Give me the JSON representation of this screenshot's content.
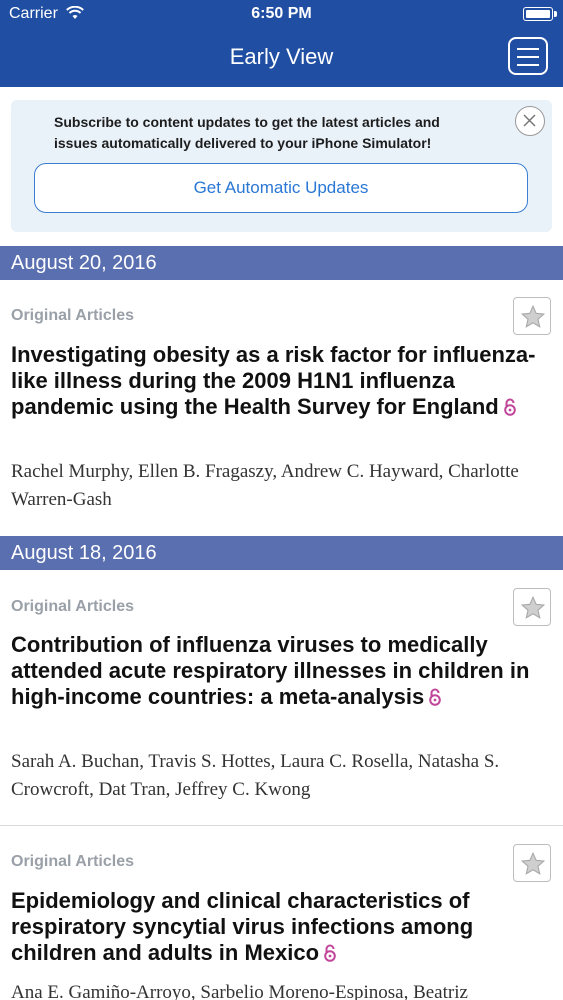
{
  "status_bar": {
    "carrier": "Carrier",
    "time": "6:50 PM"
  },
  "nav": {
    "title": "Early View",
    "menu_icon": "hamburger-menu-icon"
  },
  "subscribe": {
    "message": "Subscribe to content updates to get the latest articles and issues automatically delivered to your iPhone Simulator!",
    "button_label": "Get Automatic Updates",
    "close_icon": "close-icon"
  },
  "groups": [
    {
      "date": "August 20, 2016",
      "articles": [
        {
          "section": "Original Articles",
          "title": "Investigating obesity as a risk factor for influenza-like illness during the 2009 H1N1 influenza pandemic using the Health Survey for England",
          "open_access": true,
          "authors": "Rachel Murphy, Ellen B. Fragaszy, Andrew C. Hayward, Charlotte Warren-Gash"
        }
      ]
    },
    {
      "date": "August 18, 2016",
      "articles": [
        {
          "section": "Original Articles",
          "title": "Contribution of influenza viruses to medically attended acute respiratory illnesses in children in high-income countries: a meta-analysis",
          "open_access": true,
          "authors": "Sarah A. Buchan, Travis S. Hottes, Laura C. Rosella, Natasha S. Crowcroft, Dat Tran, Jeffrey C. Kwong"
        },
        {
          "section": "Original Articles",
          "title": "Epidemiology and clinical characteristics of respiratory syncytial virus infections among children and adults in Mexico",
          "open_access": true,
          "authors": "Ana E. Gamiño-Arroyo, Sarbelio Moreno-Espinosa, Beatriz"
        }
      ]
    }
  ],
  "colors": {
    "nav_bg": "#1f4ea3",
    "date_header_bg": "#5a6fb0",
    "accent": "#2a77d4",
    "open_access": "#c0479a"
  }
}
